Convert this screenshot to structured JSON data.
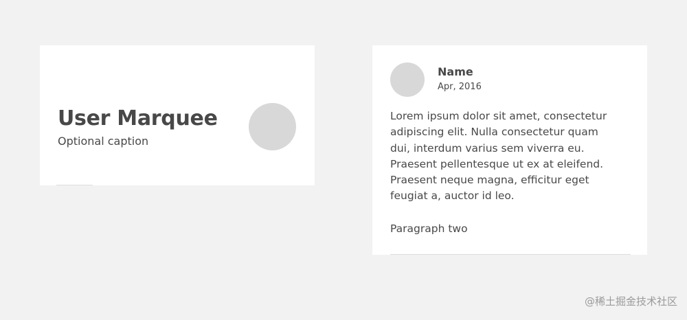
{
  "marquee": {
    "title": "User Marquee",
    "caption": "Optional caption"
  },
  "review": {
    "name": "Name",
    "date": "Apr, 2016",
    "body_lines": [
      "Lorem ipsum dolor sit amet, consectetur",
      "adipiscing elit. Nulla consectetur quam",
      "dui, interdum varius sem viverra eu.",
      "Praesent pellentesque ut ex at eleifend.",
      "Praesent neque magna, efficitur eget",
      "feugiat a, auctor id leo."
    ],
    "paragraph_two": "Paragraph two"
  },
  "watermark": "@稀土掘金技术社区",
  "colors": {
    "background": "#f2f2f2",
    "card": "#ffffff",
    "text": "#484848",
    "avatar_placeholder": "#d8d8d8",
    "divider": "#dddddd"
  }
}
